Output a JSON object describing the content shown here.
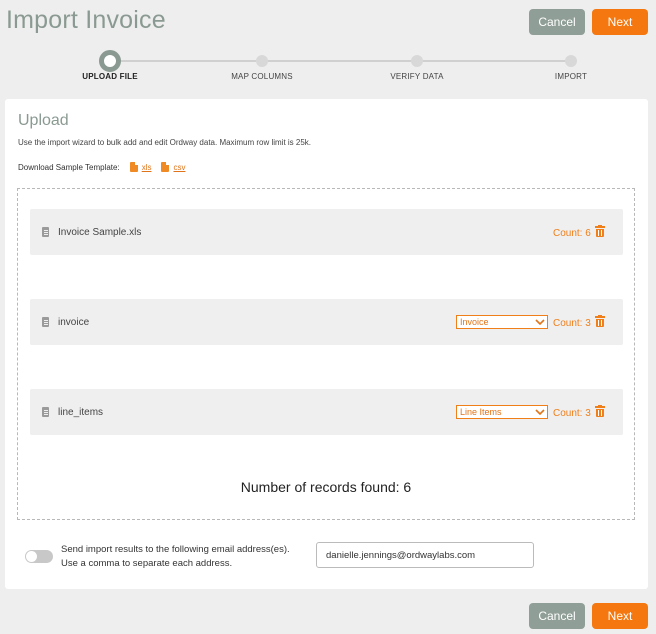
{
  "header": {
    "title": "Import Invoice",
    "cancel_label": "Cancel",
    "next_label": "Next"
  },
  "stepper": {
    "steps": [
      {
        "label": "UPLOAD FILE",
        "active": true
      },
      {
        "label": "MAP COLUMNS",
        "active": false
      },
      {
        "label": "VERIFY DATA",
        "active": false
      },
      {
        "label": "IMPORT",
        "active": false
      }
    ]
  },
  "upload": {
    "title": "Upload",
    "description": "Use the import wizard to bulk add and edit Ordway data. Maximum row limit is 25k.",
    "template_label": "Download Sample Template:",
    "template_xls": "xls",
    "template_csv": "csv"
  },
  "files": [
    {
      "name": "Invoice Sample.xls",
      "count": "Count: 6",
      "select": null
    },
    {
      "name": "invoice",
      "count": "Count: 3",
      "select": "Invoice"
    },
    {
      "name": "line_items",
      "count": "Count: 3",
      "select": "Line Items"
    }
  ],
  "records_text": "Number of records found: 6",
  "email": {
    "line1": "Send import results to the following email address(es).",
    "line2": "Use a comma to separate each address.",
    "value": "danielle.jennings@ordwaylabs.com"
  },
  "footer": {
    "cancel_label": "Cancel",
    "next_label": "Next"
  },
  "colors": {
    "accent": "#f5770f",
    "muted": "#8f9e96"
  }
}
